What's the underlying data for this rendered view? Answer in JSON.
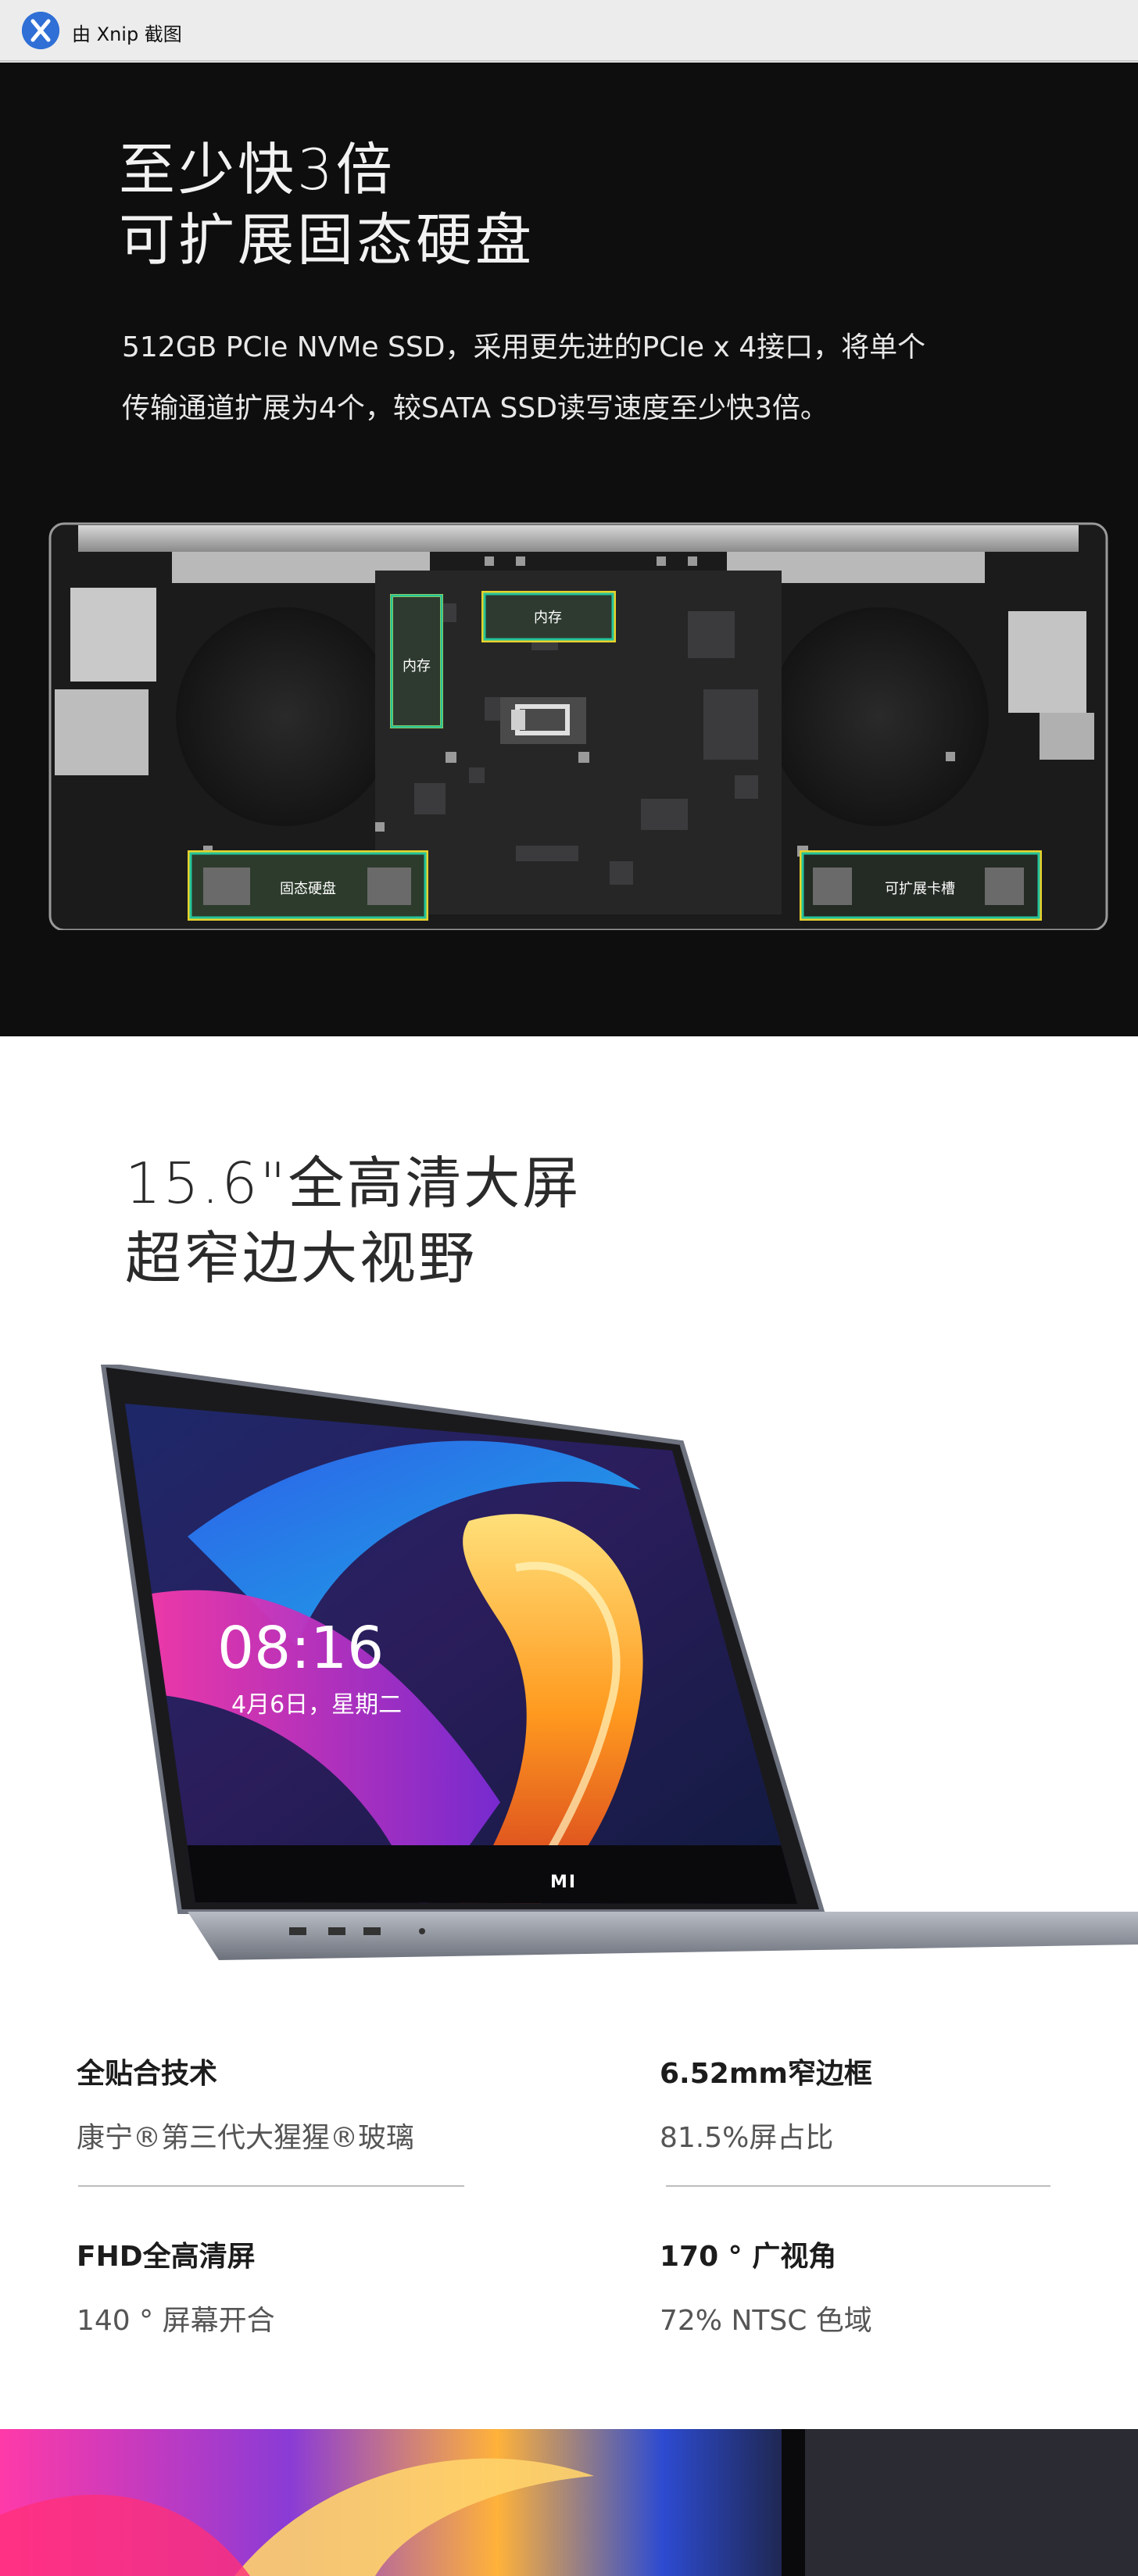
{
  "window": {
    "title": "由 Xnip 截图",
    "icon": "xnip-app-icon"
  },
  "ssd_section": {
    "title_line1": "至少快3倍",
    "title_line2": "可扩展固态硬盘",
    "desc_line1": "512GB PCIe NVMe SSD，采用更先进的PCIe x 4接口，将单个",
    "desc_line2": "传输通道扩展为4个，较SATA SSD读写速度至少快3倍。",
    "labels": {
      "memory1": "内存",
      "memory2": "内存",
      "ssd": "固态硬盘",
      "expansion": "可扩展卡槽"
    },
    "colors": {
      "background": "#0e0e0f",
      "highlight_yellow": "#e8d22a",
      "highlight_green": "#25c39a"
    }
  },
  "screen_section": {
    "title_line1": "15.6\"全高清大屏",
    "title_line2": "超窄边大视野",
    "laptop_screen": {
      "time": "08:16",
      "date": "4月6日，星期二",
      "brand": "MI"
    },
    "features": [
      {
        "title": "全贴合技术",
        "subtitle": "康宁®第三代大猩猩®玻璃"
      },
      {
        "title": "6.52mm窄边框",
        "subtitle": "81.5%屏占比"
      },
      {
        "title": "FHD全高清屏",
        "subtitle": "140 ° 屏幕开合"
      },
      {
        "title": "170 ° 广视角",
        "subtitle": "72% NTSC 色域"
      }
    ]
  }
}
